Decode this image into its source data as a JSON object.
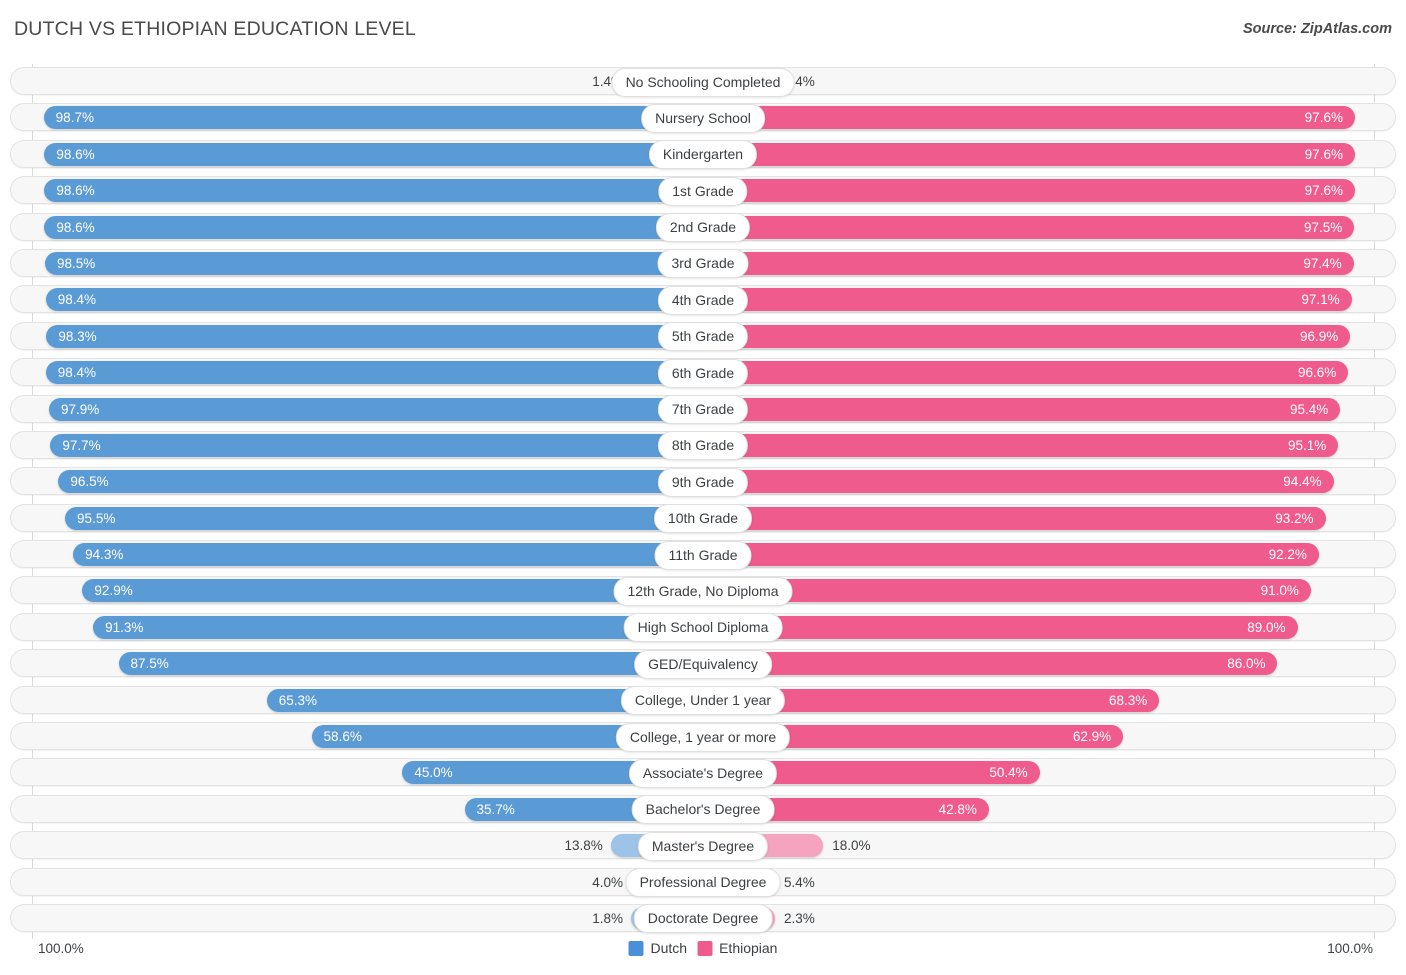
{
  "header": {
    "title": "DUTCH VS ETHIOPIAN EDUCATION LEVEL",
    "source": "Source: ZipAtlas.com"
  },
  "axis": {
    "min_label": "100.0%",
    "max_label": "100.0%"
  },
  "legend": [
    {
      "name": "dutch",
      "label": "Dutch",
      "color": "#4a90d9"
    },
    {
      "name": "ethiopian",
      "label": "Ethiopian",
      "color": "#ef5b8c"
    }
  ],
  "chart_data": {
    "type": "bar",
    "title": "DUTCH VS ETHIOPIAN EDUCATION LEVEL",
    "subtitle": "",
    "xlabel": "",
    "ylabel": "",
    "orientation": "horizontal-diverging",
    "axis_max": 100.0,
    "grid": true,
    "legend_position": "bottom-center",
    "categories": [
      "No Schooling Completed",
      "Nursery School",
      "Kindergarten",
      "1st Grade",
      "2nd Grade",
      "3rd Grade",
      "4th Grade",
      "5th Grade",
      "6th Grade",
      "7th Grade",
      "8th Grade",
      "9th Grade",
      "10th Grade",
      "11th Grade",
      "12th Grade, No Diploma",
      "High School Diploma",
      "GED/Equivalency",
      "College, Under 1 year",
      "College, 1 year or more",
      "Associate's Degree",
      "Bachelor's Degree",
      "Master's Degree",
      "Professional Degree",
      "Doctorate Degree"
    ],
    "series": [
      {
        "name": "Dutch",
        "color": "#5b9bd5",
        "side": "left",
        "values": [
          1.4,
          98.7,
          98.6,
          98.6,
          98.6,
          98.5,
          98.4,
          98.3,
          98.4,
          97.9,
          97.7,
          96.5,
          95.5,
          94.3,
          92.9,
          91.3,
          87.5,
          65.3,
          58.6,
          45.0,
          35.7,
          13.8,
          4.0,
          1.8
        ],
        "labels": [
          "1.4%",
          "98.7%",
          "98.6%",
          "98.6%",
          "98.6%",
          "98.5%",
          "98.4%",
          "98.3%",
          "98.4%",
          "97.9%",
          "97.7%",
          "96.5%",
          "95.5%",
          "94.3%",
          "92.9%",
          "91.3%",
          "87.5%",
          "65.3%",
          "58.6%",
          "45.0%",
          "35.7%",
          "13.8%",
          "4.0%",
          "1.8%"
        ]
      },
      {
        "name": "Ethiopian",
        "color": "#ef5b8c",
        "side": "right",
        "values": [
          2.4,
          97.6,
          97.6,
          97.6,
          97.5,
          97.4,
          97.1,
          96.9,
          96.6,
          95.4,
          95.1,
          94.4,
          93.2,
          92.2,
          91.0,
          89.0,
          86.0,
          68.3,
          62.9,
          50.4,
          42.8,
          18.0,
          5.4,
          2.3
        ],
        "labels": [
          "2.4%",
          "97.6%",
          "97.6%",
          "97.6%",
          "97.5%",
          "97.4%",
          "97.1%",
          "96.9%",
          "96.6%",
          "95.4%",
          "95.1%",
          "94.4%",
          "93.2%",
          "92.2%",
          "91.0%",
          "89.0%",
          "86.0%",
          "68.3%",
          "62.9%",
          "50.4%",
          "42.8%",
          "18.0%",
          "5.4%",
          "2.3%"
        ]
      }
    ]
  }
}
